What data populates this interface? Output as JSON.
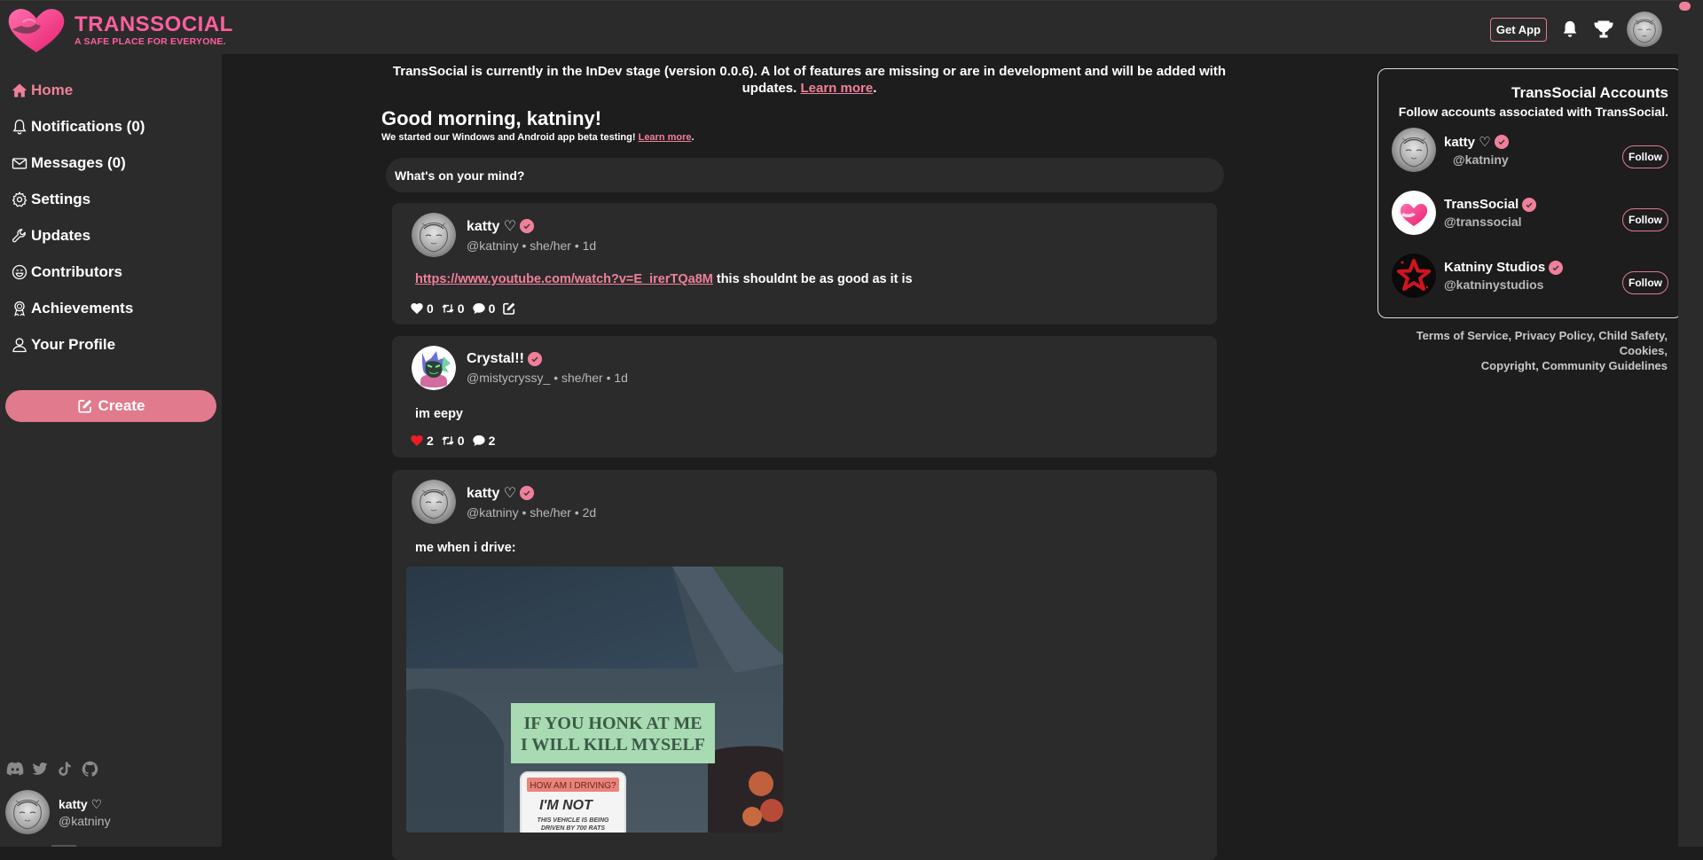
{
  "app": {
    "title": "TRANSSOCIAL",
    "tagline": "A SAFE PLACE FOR EVERYONE.",
    "accent_color": "#f0809a",
    "brand_color": "#ff5fa0"
  },
  "topbar": {
    "get_app_label": "Get App",
    "icons": [
      "bell-icon",
      "trophy-icon",
      "avatar"
    ]
  },
  "sidebar": {
    "items": [
      {
        "label": "Home",
        "icon": "home-icon",
        "active": true
      },
      {
        "label": "Notifications (0)",
        "icon": "bell-icon"
      },
      {
        "label": "Messages (0)",
        "icon": "envelope-icon"
      },
      {
        "label": "Settings",
        "icon": "gear-icon"
      },
      {
        "label": "Updates",
        "icon": "wrench-icon"
      },
      {
        "label": "Contributors",
        "icon": "smile-icon"
      },
      {
        "label": "Achievements",
        "icon": "award-icon"
      },
      {
        "label": "Your Profile",
        "icon": "user-icon"
      }
    ],
    "create_label": "Create",
    "socials": [
      "discord-icon",
      "twitter-icon",
      "tiktok-icon",
      "github-icon"
    ],
    "current_user": {
      "name": "katty ♡",
      "handle": "@katniny"
    }
  },
  "main": {
    "banner_text": "TransSocial is currently in the InDev stage (version 0.0.6). A lot of features are missing or are in development and will be added with updates.",
    "banner_link": "Learn more",
    "greeting": "Good morning, katniny!",
    "subgreeting": "We started our Windows and Android app beta testing!",
    "subgreeting_link": "Learn more",
    "composer_placeholder": "What's on your mind?",
    "posts": [
      {
        "name": "katty ♡",
        "verified": true,
        "meta": "@katniny • she/her • 1d",
        "link": "https://www.youtube.com/watch?v=E_irerTQa8M",
        "text": "this shouldnt be as good as it is",
        "likes": "0",
        "reposts": "0",
        "comments": "0",
        "liked": false,
        "editable": true
      },
      {
        "name": "Crystal!!",
        "verified": true,
        "meta": "@mistycryssy_ • she/her • 1d",
        "text": "im eepy",
        "likes": "2",
        "reposts": "0",
        "comments": "2",
        "liked": true
      },
      {
        "name": "katty ♡",
        "verified": true,
        "meta": "@katniny • she/her • 2d",
        "text": "me when i drive:",
        "image": {
          "sticker_1": [
            "IF YOU HONK AT ME",
            "I WILL KILL MYSELF"
          ],
          "sticker_2_header": "HOW AM I DRIVING?",
          "sticker_2_main": "I'M NOT",
          "sticker_2_footer": [
            "THIS VEHICLE IS BEING",
            "DRIVEN BY 700 RATS"
          ]
        }
      }
    ]
  },
  "right": {
    "title": "TransSocial Accounts",
    "subtitle": "Follow accounts associated with TransSocial.",
    "follow_label": "Follow",
    "accounts": [
      {
        "name": "katty ♡",
        "handle": "@katniny",
        "verified": true
      },
      {
        "name": "TransSocial",
        "handle": "@transsocial",
        "verified": true
      },
      {
        "name": "Katniny Studios",
        "handle": "@katninystudios",
        "verified": true
      }
    ],
    "legal": [
      "Terms of Service",
      "Privacy Policy",
      "Child Safety",
      "Cookies",
      "Copyright",
      "Community Guidelines"
    ]
  }
}
